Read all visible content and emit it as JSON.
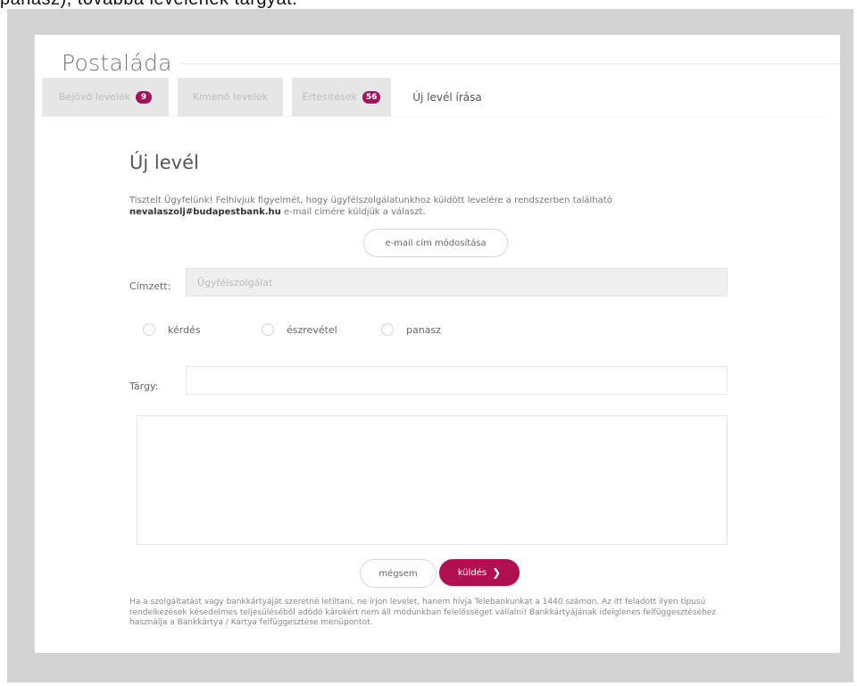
{
  "caption": "panasz), továbbá levelének tárgyát.",
  "header": {
    "title": "Postaláda"
  },
  "tabs": [
    {
      "label": "Bejövő levelek",
      "badge": "9"
    },
    {
      "label": "Kimenő levelek"
    },
    {
      "label": "Értesítések",
      "badge": "56"
    },
    {
      "label": "Új levél írása",
      "active": true
    }
  ],
  "form": {
    "heading": "Új levél",
    "notice_pre": "Tisztelt Ügyfelünk! Felhívjuk figyelmét, hogy ügyfélszolgálatunkhoz küldött levelére a rendszerben található",
    "notice_email": "nevalaszolj#budapestbank.hu",
    "notice_post": "e-mail címére küldjük a választ.",
    "change_email_label": "e-mail cím módosítása",
    "recipient_label": "Címzett:",
    "recipient_value": "Ügyfélszolgálat",
    "radio_options": [
      "kérdés",
      "észrevétel",
      "panasz"
    ],
    "subject_label": "Tárgy:",
    "subject_value": "",
    "message_value": "",
    "cancel_label": "mégsem",
    "send_label": "küldés"
  },
  "footer_note": "Ha a szolgáltatást vagy bankkártyáját szeretné letiltani, ne írjon levelet, hanem hívja Telebankunkat a 1440 számon. Az itt feladott ilyen típusú rendelkezések késedelmes teljesüléséből adódó károkért nem áll módunkban felelősséget vállalni! Bankkártyájának ideiglenes felfüggesztéséhez használja a Bankkártya / Kártya felfüggesztése menüpontot.",
  "colors": {
    "accent": "#b0104f",
    "badge": "#a0145a",
    "frame": "#d3d3d3"
  }
}
